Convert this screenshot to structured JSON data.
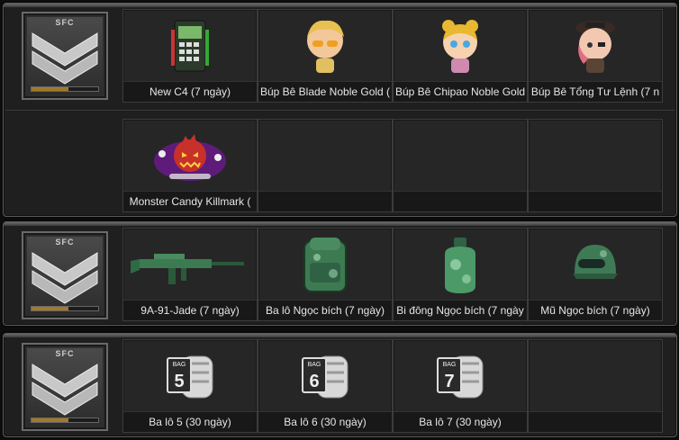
{
  "rank_badge_text": "SFC",
  "rank_progress": 0.55,
  "sections": [
    {
      "rows": [
        [
          {
            "label": "New C4 (7 ngày)",
            "icon": "c4-bomb-icon"
          },
          {
            "label": "Búp Bê Blade Noble Gold (",
            "icon": "doll-blade-icon"
          },
          {
            "label": "Búp Bê Chipao Noble Gold",
            "icon": "doll-chipao-icon"
          },
          {
            "label": "Búp Bê Tổng Tư Lệnh (7 n",
            "icon": "doll-commander-icon"
          }
        ],
        [
          {
            "label": "Monster Candy Killmark (",
            "icon": "monster-candy-icon"
          },
          {
            "label": "",
            "icon": ""
          },
          {
            "label": "",
            "icon": ""
          },
          {
            "label": "",
            "icon": ""
          }
        ]
      ]
    },
    {
      "rows": [
        [
          {
            "label": "9A-91-Jade (7 ngày)",
            "icon": "rifle-icon"
          },
          {
            "label": "Ba lô Ngọc bích (7 ngày)",
            "icon": "backpack-icon"
          },
          {
            "label": "Bi đông Ngọc bích (7 ngày",
            "icon": "canteen-icon"
          },
          {
            "label": "Mũ Ngọc bích (7 ngày)",
            "icon": "helmet-icon"
          }
        ]
      ]
    },
    {
      "rows": [
        [
          {
            "label": "Ba lô 5 (30 ngày)",
            "icon": "bag-5-icon",
            "bag_word": "BAG",
            "bag_number": "5"
          },
          {
            "label": "Ba lô 6 (30 ngày)",
            "icon": "bag-6-icon",
            "bag_word": "BAG",
            "bag_number": "6"
          },
          {
            "label": "Ba lô 7 (30 ngày)",
            "icon": "bag-7-icon",
            "bag_word": "BAG",
            "bag_number": "7"
          },
          {
            "label": "",
            "icon": ""
          }
        ]
      ]
    }
  ]
}
